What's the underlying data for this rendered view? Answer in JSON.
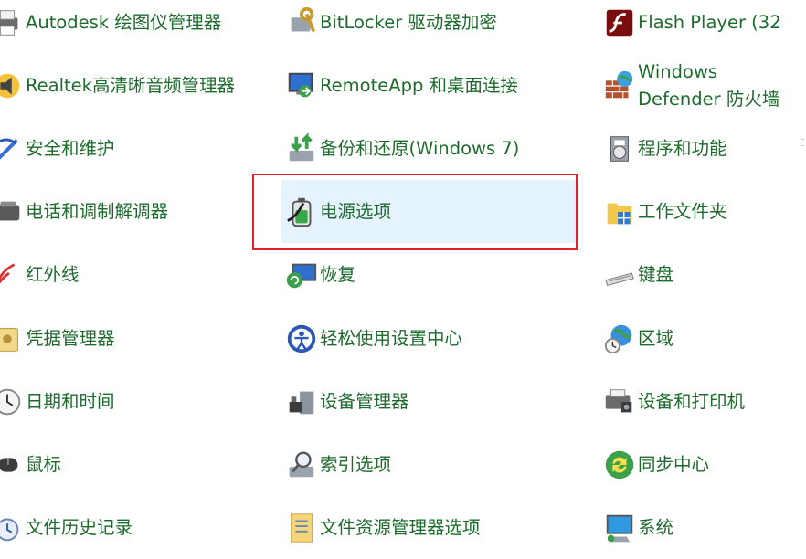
{
  "control_panel": {
    "columns": [
      [
        {
          "label": "Autodesk 绘图仪管理器",
          "icon": "printer-icon"
        },
        {
          "label": "Realtek高清晰音频管理器",
          "icon": "speaker-icon"
        },
        {
          "label": "安全和维护",
          "icon": "flag-icon"
        },
        {
          "label": "电话和调制解调器",
          "icon": "phone-icon"
        },
        {
          "label": "红外线",
          "icon": "infrared-icon"
        },
        {
          "label": "凭据管理器",
          "icon": "vault-icon"
        },
        {
          "label": "日期和时间",
          "icon": "clock-icon"
        },
        {
          "label": "鼠标",
          "icon": "mouse-icon"
        },
        {
          "label": "文件历史记录",
          "icon": "file-history-icon"
        }
      ],
      [
        {
          "label": "BitLocker 驱动器加密",
          "icon": "bitlocker-icon"
        },
        {
          "label": "RemoteApp 和桌面连接",
          "icon": "remoteapp-icon"
        },
        {
          "label": "备份和还原(Windows 7)",
          "icon": "backup-icon"
        },
        {
          "label": "电源选项",
          "icon": "battery-icon"
        },
        {
          "label": "恢复",
          "icon": "recovery-icon"
        },
        {
          "label": "轻松使用设置中心",
          "icon": "ease-of-access-icon"
        },
        {
          "label": "设备管理器",
          "icon": "device-manager-icon"
        },
        {
          "label": "索引选项",
          "icon": "indexing-icon"
        },
        {
          "label": "文件资源管理器选项",
          "icon": "folder-options-icon"
        }
      ],
      [
        {
          "label": "Flash Player (32",
          "icon": "flash-icon"
        },
        {
          "label": "Windows Defender 防火墙",
          "icon": "firewall-icon"
        },
        {
          "label": "程序和功能",
          "icon": "programs-icon"
        },
        {
          "label": "工作文件夹",
          "icon": "work-folders-icon"
        },
        {
          "label": "键盘",
          "icon": "keyboard-icon"
        },
        {
          "label": "区域",
          "icon": "region-icon"
        },
        {
          "label": "设备和打印机",
          "icon": "devices-printers-icon"
        },
        {
          "label": "同步中心",
          "icon": "sync-icon"
        },
        {
          "label": "系统",
          "icon": "system-icon"
        }
      ]
    ],
    "hovered": "电源选项",
    "colors": {
      "link": "#1e6b2d",
      "hover_bg": "#e5f3ff",
      "highlight_border": "#e0202a"
    }
  }
}
